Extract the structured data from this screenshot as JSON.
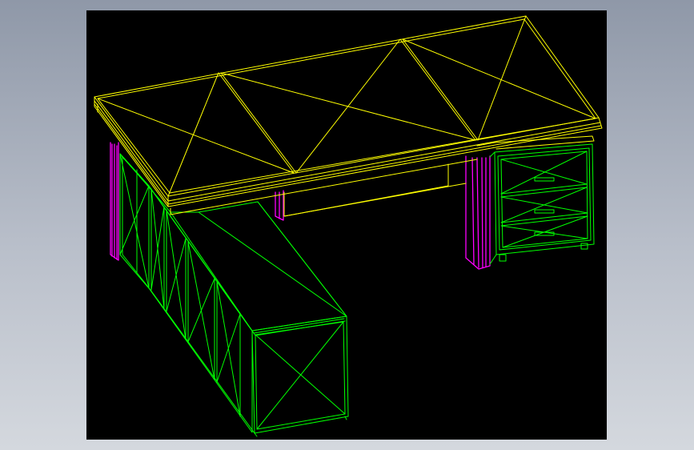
{
  "colors": {
    "background_gradient_top": "#8f98a8",
    "background_gradient_bottom": "#d4d8de",
    "viewport_background": "#000000",
    "desktop_top": "#ffff00",
    "cabinets": "#00ff00",
    "legs": "#ff00ff"
  },
  "icons": {
    "model": "wireframe-desk-model-icon"
  }
}
